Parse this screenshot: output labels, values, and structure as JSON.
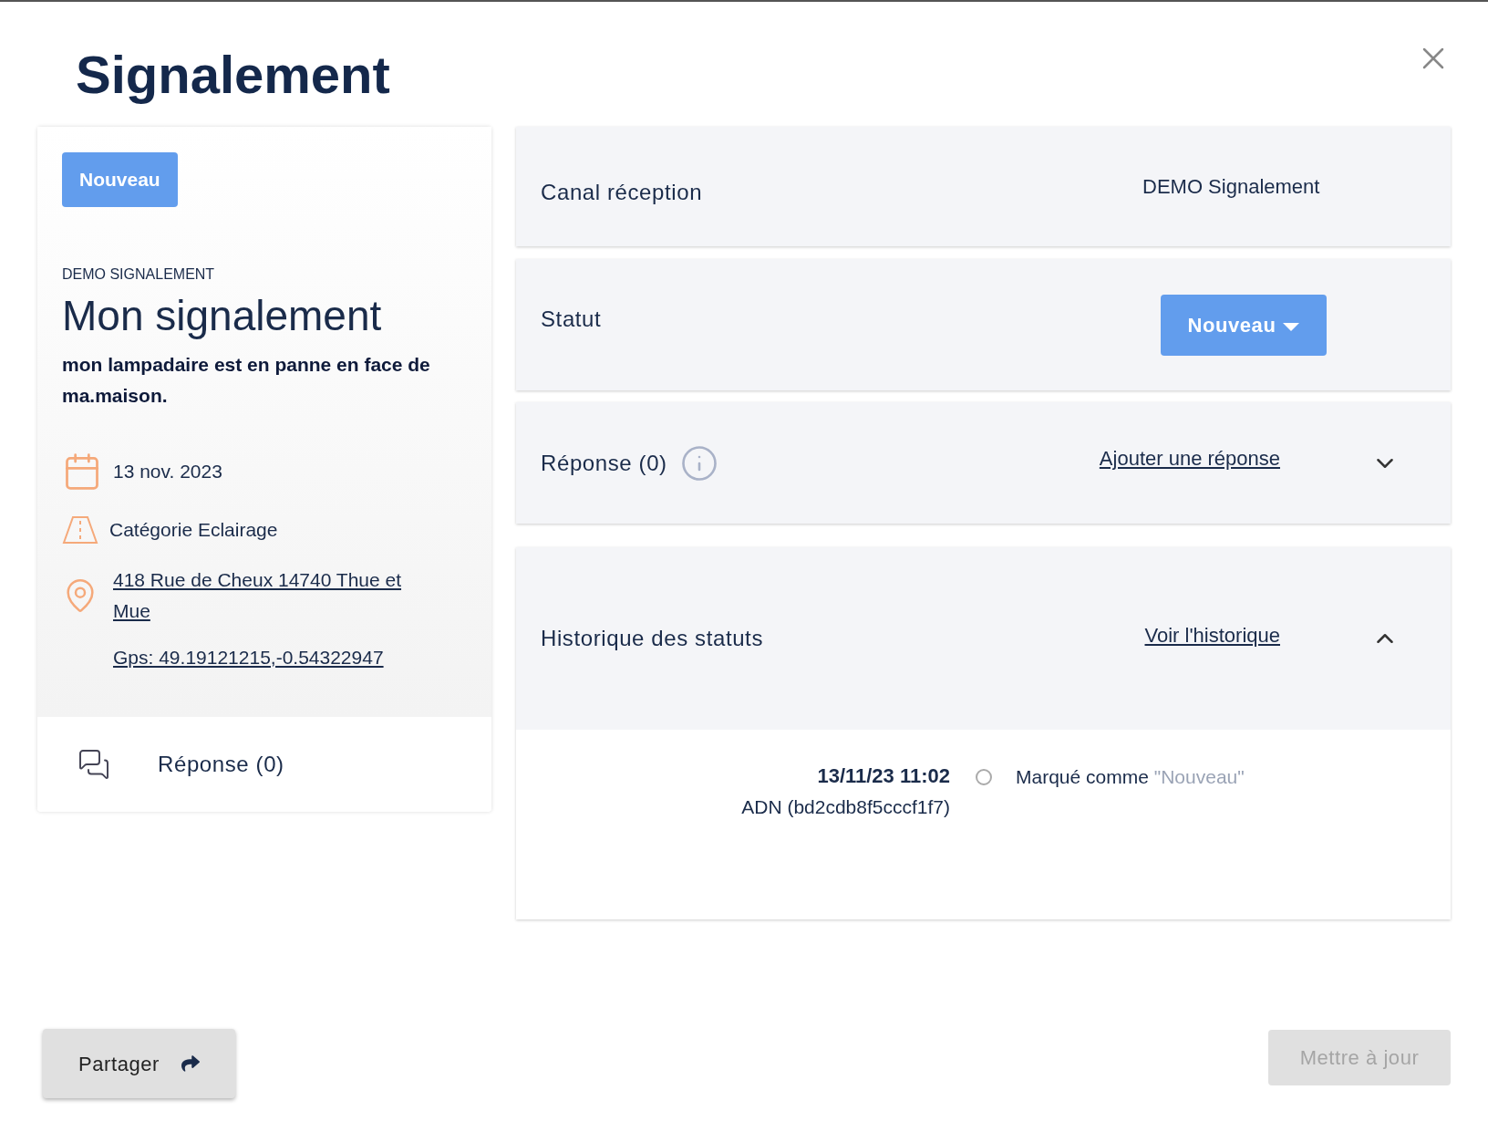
{
  "dialog": {
    "title": "Signalement"
  },
  "summary": {
    "status_badge": "Nouveau",
    "source": "DEMO SIGNALEMENT",
    "title": "Mon signalement",
    "description": "mon lampadaire est en panne en face de ma.maison.",
    "date": "13 nov. 2023",
    "category": "Catégorie Eclairage",
    "address": "418 Rue de Cheux 14740 Thue et Mue",
    "gps": "Gps: 49.19121215,-0.54322947",
    "responses": "Réponse (0)"
  },
  "channel": {
    "label": "Canal réception",
    "value": "DEMO Signalement"
  },
  "status": {
    "label": "Statut",
    "value": "Nouveau"
  },
  "responses": {
    "label": "Réponse (0)",
    "link": "Ajouter une réponse",
    "expanded": false
  },
  "history": {
    "label": "Historique des statuts",
    "link": "Voir l'historique",
    "expanded": true,
    "entries": [
      {
        "time": "13/11/23 11:02",
        "author": "ADN (bd2cdb8f5cccf1f7)",
        "action": "Marqué comme",
        "status": "\"Nouveau\""
      }
    ]
  },
  "actions": {
    "share": "Partager",
    "update": "Mettre à jour",
    "update_disabled": true
  }
}
